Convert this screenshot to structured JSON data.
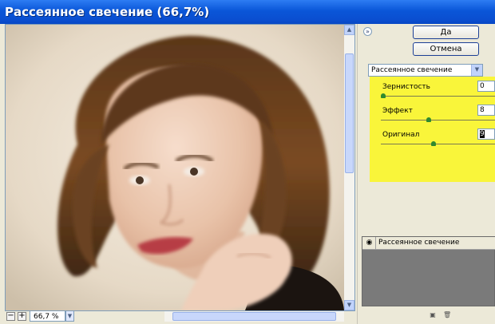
{
  "window": {
    "title": "Рассеянное свечение (66,7%)"
  },
  "preview": {
    "image_alt": "Portrait photo of a woman with dark brown bob hair, chin resting on hand",
    "zoom_out_glyph": "−",
    "zoom_in_glyph": "+",
    "zoom_value": "66,7 %",
    "scroll_up_glyph": "▲",
    "scroll_down_glyph": "▼",
    "dropdown_glyph": "▼"
  },
  "buttons": {
    "ok": "Да",
    "cancel": "Отмена"
  },
  "panel": {
    "collapse_glyph": "»",
    "filter_selected": "Рассеянное свечение",
    "dropdown_glyph": "▼",
    "params": [
      {
        "label": "Зернистость",
        "value": "0",
        "level": 0.0
      },
      {
        "label": "Эффект",
        "value": "8",
        "level": 0.4
      },
      {
        "label": "Оригинал",
        "value": "9",
        "level": 0.45
      }
    ]
  },
  "layers": {
    "eye_glyph": "◉",
    "items": [
      {
        "name": "Рассеянное свечение"
      }
    ],
    "new_glyph": "▣",
    "delete_glyph": "🗑"
  },
  "colors": {
    "highlight": "#f9f53a",
    "titlebar": "#0a56d8"
  }
}
